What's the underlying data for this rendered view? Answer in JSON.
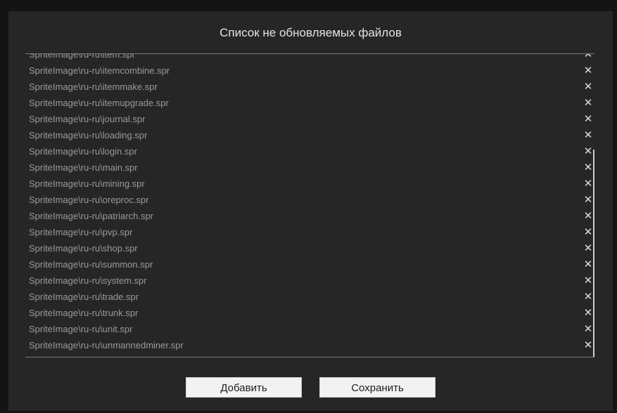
{
  "dialog": {
    "title": "Список не обновляемых файлов"
  },
  "files": [
    "SpriteImage\\ru-ru\\item.spr",
    "SpriteImage\\ru-ru\\itemcombine.spr",
    "SpriteImage\\ru-ru\\itemmake.spr",
    "SpriteImage\\ru-ru\\itemupgrade.spr",
    "SpriteImage\\ru-ru\\journal.spr",
    "SpriteImage\\ru-ru\\loading.spr",
    "SpriteImage\\ru-ru\\login.spr",
    "SpriteImage\\ru-ru\\main.spr",
    "SpriteImage\\ru-ru\\mining.spr",
    "SpriteImage\\ru-ru\\oreproc.spr",
    "SpriteImage\\ru-ru\\patriarch.spr",
    "SpriteImage\\ru-ru\\pvp.spr",
    "SpriteImage\\ru-ru\\shop.spr",
    "SpriteImage\\ru-ru\\summon.spr",
    "SpriteImage\\ru-ru\\system.spr",
    "SpriteImage\\ru-ru\\trade.spr",
    "SpriteImage\\ru-ru\\trunk.spr",
    "SpriteImage\\ru-ru\\unit.spr",
    "SpriteImage\\ru-ru\\unmannedminer.spr"
  ],
  "remove_glyph": "✕",
  "remove_icon": "close-icon",
  "buttons": {
    "add_label": "Добавить",
    "save_label": "Сохранить"
  },
  "colors": {
    "background": "#141414",
    "panel": "#262626",
    "file_text": "#9a9a9a",
    "button_bg": "#f2f2f2"
  }
}
